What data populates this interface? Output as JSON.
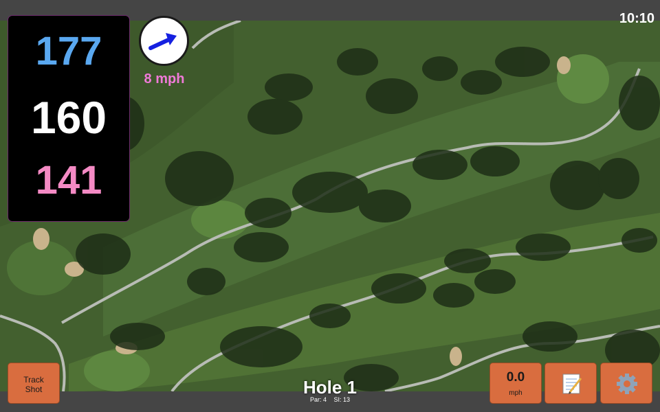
{
  "status_bar": {
    "time": "10:10"
  },
  "distances": {
    "back": "177",
    "middle": "160",
    "front": "141"
  },
  "wind": {
    "speed": "8 mph",
    "direction_icon": "arrow-right-up-icon"
  },
  "buttons": {
    "track_shot_line1": "Track",
    "track_shot_line2": "Shot",
    "speed_value": "0.0",
    "speed_unit": "mph",
    "notes_icon": "notepad-icon",
    "settings_icon": "gear-icon"
  },
  "hole": {
    "title": "Hole 1",
    "par": "Par: 4",
    "si": "SI: 13"
  },
  "colors": {
    "back_distance": "#5aa8f0",
    "middle_distance": "#ffffff",
    "front_distance": "#f48ac4",
    "wind_text": "#f07ad8",
    "button": "#d96d3f"
  }
}
